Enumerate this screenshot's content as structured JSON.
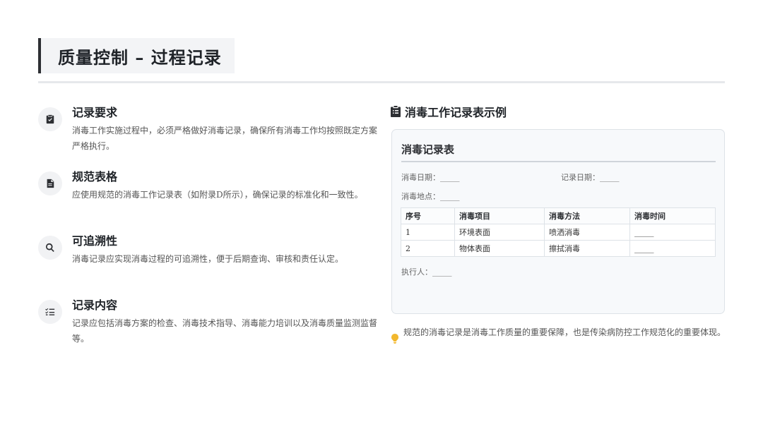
{
  "header": {
    "title": "质量控制 – 过程记录"
  },
  "items": [
    {
      "icon": "clipboard-check-icon",
      "title": "记录要求",
      "desc": "消毒工作实施过程中，必须严格做好消毒记录，确保所有消毒工作均按照既定方案严格执行。"
    },
    {
      "icon": "file-icon",
      "title": "规范表格",
      "desc": "应使用规范的消毒工作记录表（如附录D所示），确保记录的标准化和一致性。"
    },
    {
      "icon": "search-icon",
      "title": "可追溯性",
      "desc": "消毒记录应实现消毒过程的可追溯性，便于后期查询、审核和责任认定。"
    },
    {
      "icon": "list-check-icon",
      "title": "记录内容",
      "desc": "记录应包括消毒方案的检查、消毒技术指导、消毒能力培训以及消毒质量监测监督等。"
    }
  ],
  "example": {
    "heading": "消毒工作记录表示例",
    "form_title": "消毒记录表",
    "fields": {
      "disinfect_date": "消毒日期：_____",
      "record_date": "记录日期：_____",
      "location": "消毒地点：_____",
      "executor": "执行人：_____"
    },
    "table": {
      "headers": [
        "序号",
        "消毒项目",
        "消毒方法",
        "消毒时间"
      ],
      "rows": [
        [
          "1",
          "环境表面",
          "喷洒消毒",
          "_____"
        ],
        [
          "2",
          "物体表面",
          "擦拭消毒",
          "_____"
        ]
      ]
    }
  },
  "note": {
    "icon": "lightbulb-icon",
    "text": "规范的消毒记录是消毒工作质量的重要保障，也是传染病防控工作规范化的重要体现。"
  }
}
